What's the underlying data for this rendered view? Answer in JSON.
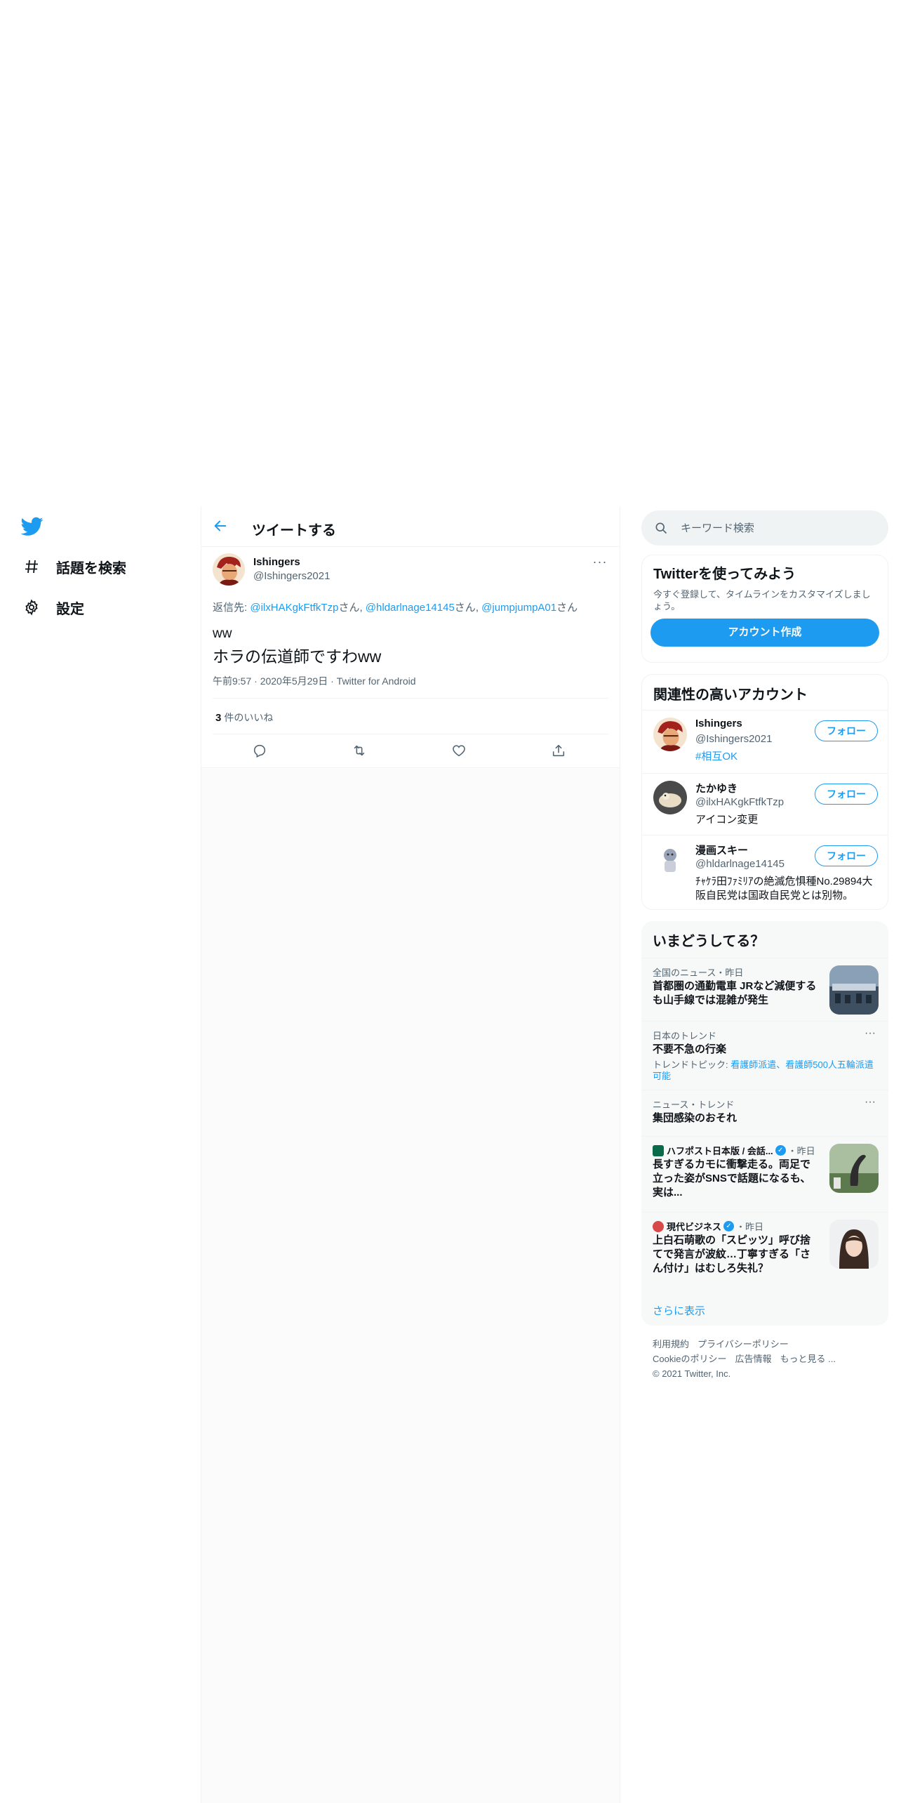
{
  "nav": {
    "items": [
      {
        "label": "話題を検索",
        "icon": "hashtag-icon"
      },
      {
        "label": "設定",
        "icon": "gear-icon"
      }
    ]
  },
  "header": {
    "title": "ツイートする"
  },
  "tweet": {
    "name": "Ishingers",
    "handle": "@Ishingers2021",
    "reply_prefix": "返信先: ",
    "reply_users": [
      "@ilxHAKgkFtfkTzp",
      "@hldarlnage14145",
      "@jumpjumpA01"
    ],
    "reply_suffix": "さん",
    "reply_sep": ", ",
    "text_line1": "ww",
    "text_line2": "ホラの伝道師ですわww",
    "time": "午前9:57",
    "date": "2020年5月29日",
    "source": "Twitter for Android",
    "like_count": "3",
    "like_label": "件のいいね"
  },
  "search": {
    "placeholder": "キーワード検索"
  },
  "signup": {
    "title": "Twitterを使ってみよう",
    "subtitle": "今すぐ登録して、タイムラインをカスタマイズしましょう。",
    "button": "アカウント作成"
  },
  "related": {
    "title": "関連性の高いアカウント",
    "follow_label": "フォロー",
    "accounts": [
      {
        "name": "Ishingers",
        "handle": "@Ishingers2021",
        "bio": "#相互OK"
      },
      {
        "name": "たかゆき",
        "handle": "@ilxHAKgkFtfkTzp",
        "bio": "アイコン変更"
      },
      {
        "name": "漫画スキー",
        "handle": "@hldarlnage14145",
        "bio": "ﾁｬｹﾗ田ﾌｧﾐﾘｱの絶滅危惧種No.29894大阪自民党は国政自民党とは別物。"
      }
    ]
  },
  "trends": {
    "title": "いまどうしてる？",
    "items": [
      {
        "context": "全国のニュース・昨日",
        "title": "首都圏の通勤電車 JRなど減便するも山手線では混雑が発生"
      },
      {
        "context": "日本のトレンド",
        "title": "不要不急の行楽",
        "sub_prefix": "トレンドトピック: ",
        "sub_links": "看護師派遣、看護師500人五輪派遣可能"
      },
      {
        "context": "ニュース・トレンド",
        "title": "集団感染のおそれ"
      },
      {
        "source": "ハフポスト日本版 / 会話...",
        "time": "・昨日",
        "title": "長すぎるカモに衝撃走る。両足で立った姿がSNSで話題になるも、実は..."
      },
      {
        "source": "現代ビジネス",
        "time": "・昨日",
        "title": "上白石萌歌の「スピッツ」呼び捨てで発言が波紋…丁寧すぎる「さん付け」はむしろ失礼？"
      }
    ],
    "show_more": "さらに表示"
  },
  "footer": {
    "links": [
      "利用規約",
      "プライバシーポリシー",
      "Cookieのポリシー",
      "広告情報",
      "もっと見る ..."
    ],
    "copyright": "© 2021 Twitter, Inc."
  },
  "colors": {
    "accent": "#1d9bf0",
    "text": "#0f1419",
    "muted": "#536471",
    "border": "#eff3f4"
  }
}
